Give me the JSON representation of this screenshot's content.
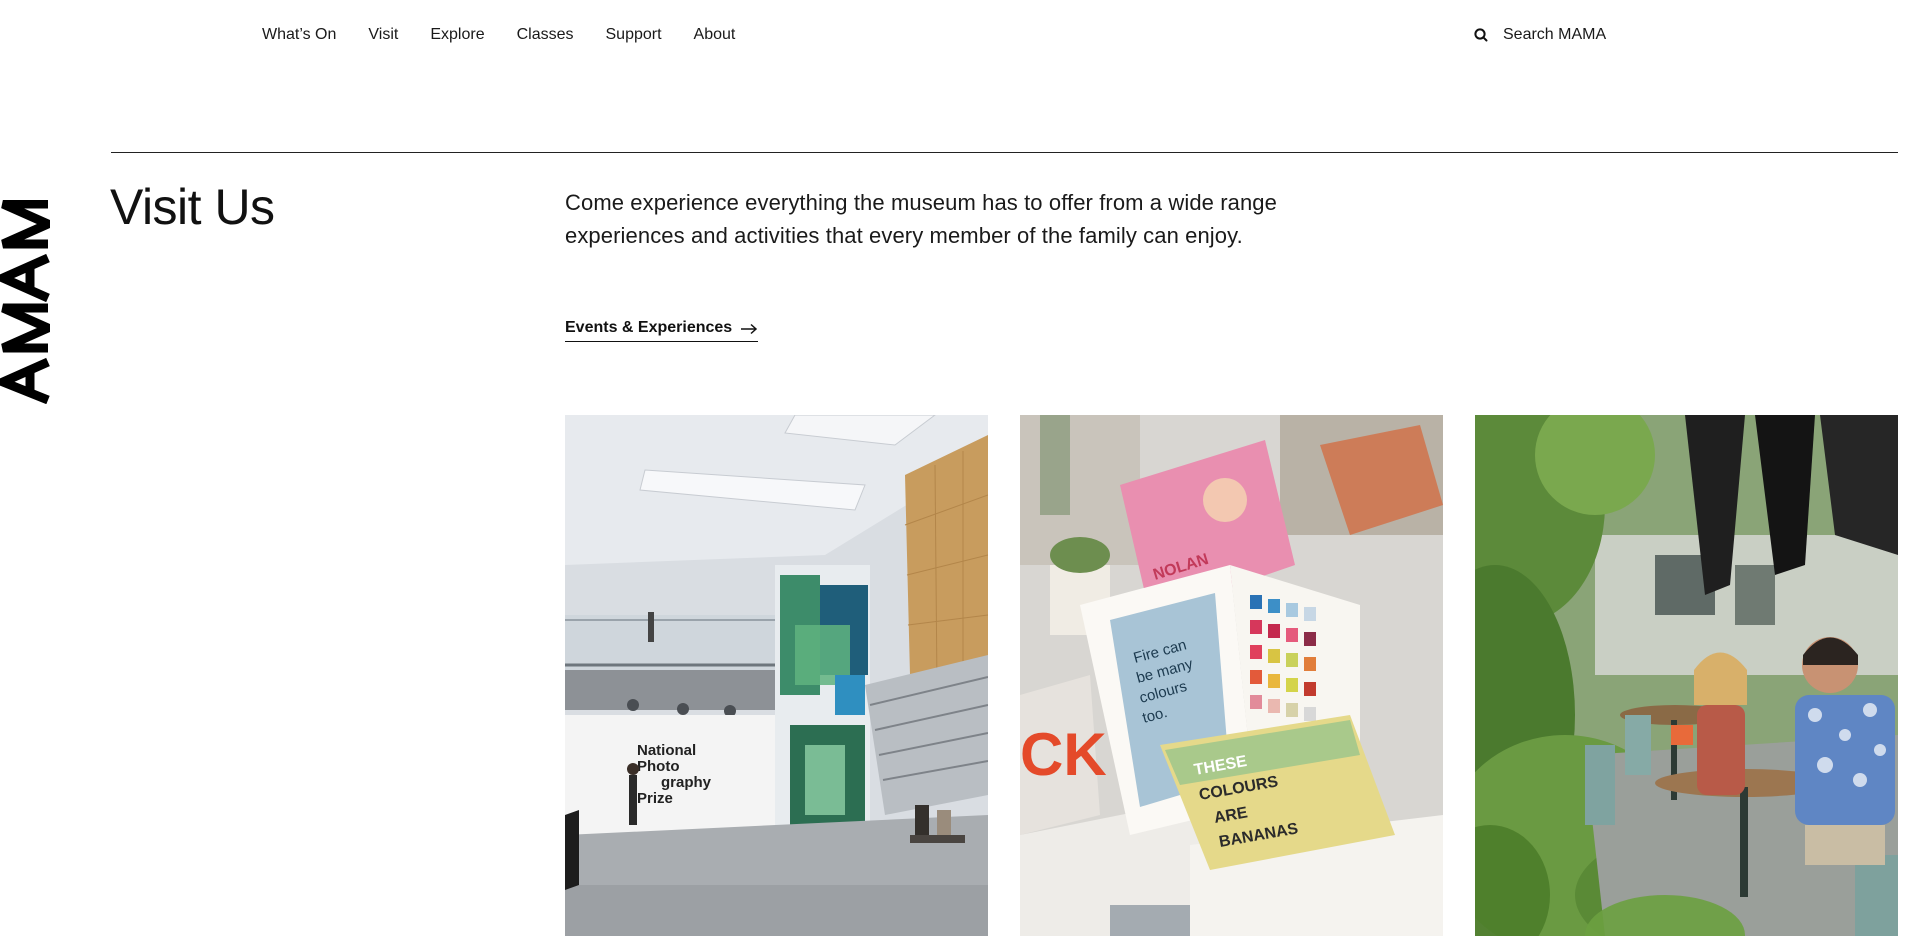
{
  "nav": {
    "items": [
      {
        "label": "What’s On"
      },
      {
        "label": "Visit"
      },
      {
        "label": "Explore"
      },
      {
        "label": "Classes"
      },
      {
        "label": "Support"
      },
      {
        "label": "About"
      }
    ]
  },
  "search": {
    "label": "Search MAMA",
    "icon": "search-icon"
  },
  "logo": {
    "text": "MAMA"
  },
  "page": {
    "title": "Visit Us",
    "intro": "Come experience everything the museum has to offer from a wide range experiences and activities that every member of the family can enjoy.",
    "cta_label": "Events & Experiences"
  },
  "cards": [
    {
      "image": "gallery-interior-photo",
      "wall_text": "National Photography Prize"
    },
    {
      "image": "picture-book-photo",
      "book_text": "Fire can be many colours too.",
      "book_title": "THESE COLOURS ARE BANANAS"
    },
    {
      "image": "cafe-courtyard-photo"
    }
  ],
  "colors": {
    "text": "#111111",
    "background": "#ffffff"
  }
}
